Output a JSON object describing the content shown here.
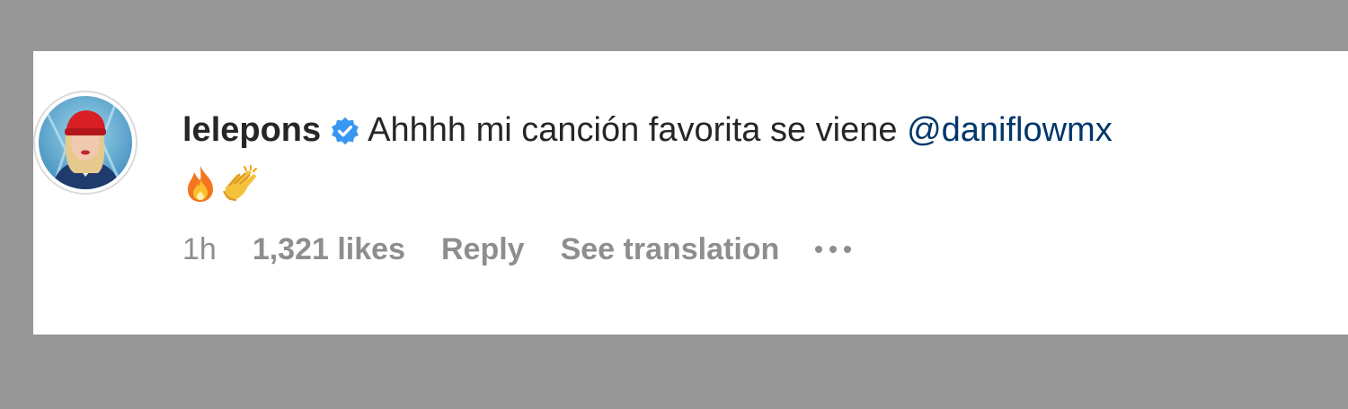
{
  "comment": {
    "username": "lelepons",
    "verified": true,
    "text": "Ahhhh mi canción favorita se viene",
    "mention": "@daniflowmx",
    "emojis": [
      "fire-emoji",
      "clapping-hands-emoji"
    ]
  },
  "meta": {
    "time": "1h",
    "likes": "1,321 likes",
    "reply": "Reply",
    "see_translation": "See translation",
    "more_icon": "more-options-icon"
  },
  "colors": {
    "background": "#979797",
    "card": "#ffffff",
    "text": "#262626",
    "secondary": "#8e8e8e",
    "mention": "#00376b",
    "verified_badge": "#3897f0"
  }
}
